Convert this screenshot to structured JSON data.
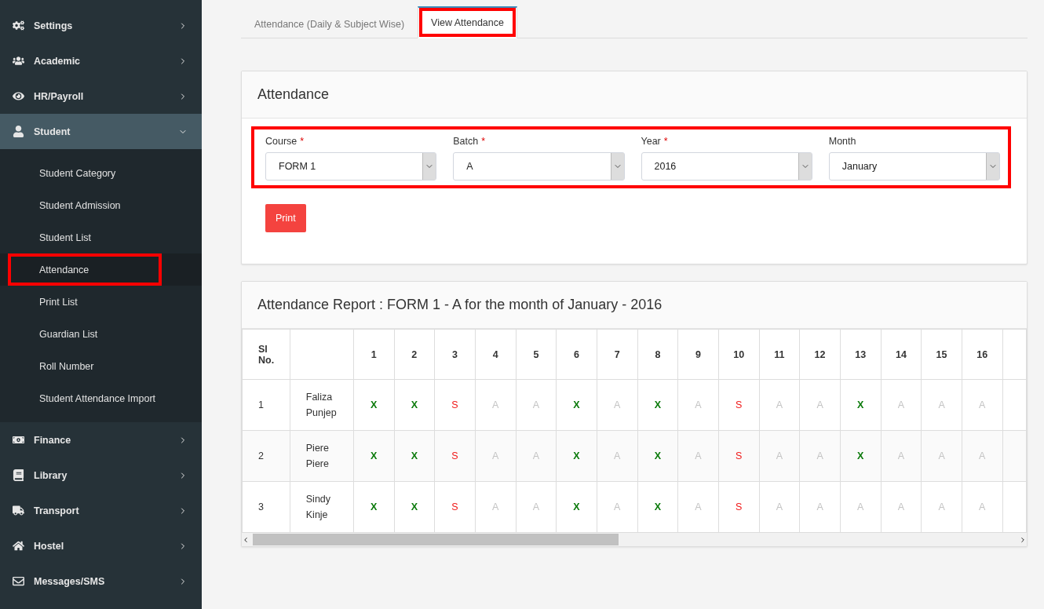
{
  "sidebar": {
    "items": [
      {
        "label": "Settings",
        "expanded": false,
        "selected": false
      },
      {
        "label": "Academic",
        "expanded": false,
        "selected": false
      },
      {
        "label": "HR/Payroll",
        "expanded": false,
        "selected": false
      },
      {
        "label": "Student",
        "expanded": true,
        "selected": true,
        "children": [
          {
            "label": "Student Category",
            "selected": false,
            "highlighted": false
          },
          {
            "label": "Student Admission",
            "selected": false,
            "highlighted": false
          },
          {
            "label": "Student List",
            "selected": false,
            "highlighted": false
          },
          {
            "label": "Attendance",
            "selected": true,
            "highlighted": true
          },
          {
            "label": "Print List",
            "selected": false,
            "highlighted": false
          },
          {
            "label": "Guardian List",
            "selected": false,
            "highlighted": false
          },
          {
            "label": "Roll Number",
            "selected": false,
            "highlighted": false
          },
          {
            "label": "Student Attendance Import",
            "selected": false,
            "highlighted": false
          }
        ]
      },
      {
        "label": "Finance",
        "expanded": false,
        "selected": false
      },
      {
        "label": "Library",
        "expanded": false,
        "selected": false
      },
      {
        "label": "Transport",
        "expanded": false,
        "selected": false
      },
      {
        "label": "Hostel",
        "expanded": false,
        "selected": false
      },
      {
        "label": "Messages/SMS",
        "expanded": false,
        "selected": false
      }
    ]
  },
  "tabs": [
    {
      "label": "Attendance (Daily & Subject Wise)",
      "selected": false,
      "highlighted": false
    },
    {
      "label": "View Attendance",
      "selected": true,
      "highlighted": true
    }
  ],
  "filter_panel": {
    "title": "Attendance",
    "highlighted": true,
    "fields": [
      {
        "label": "Course",
        "required": true,
        "value": "FORM 1"
      },
      {
        "label": "Batch",
        "required": true,
        "value": "A"
      },
      {
        "label": "Year",
        "required": true,
        "value": "2016"
      },
      {
        "label": "Month",
        "required": false,
        "value": "January"
      }
    ],
    "required_mark": "*",
    "print_button": "Print"
  },
  "report": {
    "title": "Attendance Report : FORM 1 - A for the month of January - 2016",
    "columns": [
      "Sl No.",
      "",
      "1",
      "2",
      "3",
      "4",
      "5",
      "6",
      "7",
      "8",
      "9",
      "10",
      "11",
      "12",
      "13",
      "14",
      "15",
      "16"
    ],
    "rows": [
      {
        "sl": "1",
        "name": "Faliza Punjep",
        "days": [
          {
            "text": "X",
            "kind": "present"
          },
          {
            "text": "X",
            "kind": "present"
          },
          {
            "text": "S",
            "kind": "special"
          },
          {
            "text": "A",
            "kind": "absent"
          },
          {
            "text": "A",
            "kind": "absent"
          },
          {
            "text": "X",
            "kind": "present"
          },
          {
            "text": "A",
            "kind": "absent"
          },
          {
            "text": "X",
            "kind": "present"
          },
          {
            "text": "A",
            "kind": "absent"
          },
          {
            "text": "S",
            "kind": "special"
          },
          {
            "text": "A",
            "kind": "absent"
          },
          {
            "text": "A",
            "kind": "absent"
          },
          {
            "text": "X",
            "kind": "present"
          },
          {
            "text": "A",
            "kind": "absent"
          },
          {
            "text": "A",
            "kind": "absent"
          },
          {
            "text": "A",
            "kind": "absent"
          }
        ]
      },
      {
        "sl": "2",
        "name": "Piere Piere",
        "days": [
          {
            "text": "X",
            "kind": "present"
          },
          {
            "text": "X",
            "kind": "present"
          },
          {
            "text": "S",
            "kind": "special"
          },
          {
            "text": "A",
            "kind": "absent"
          },
          {
            "text": "A",
            "kind": "absent"
          },
          {
            "text": "X",
            "kind": "present"
          },
          {
            "text": "A",
            "kind": "absent"
          },
          {
            "text": "X",
            "kind": "present"
          },
          {
            "text": "A",
            "kind": "absent"
          },
          {
            "text": "S",
            "kind": "special"
          },
          {
            "text": "A",
            "kind": "absent"
          },
          {
            "text": "A",
            "kind": "absent"
          },
          {
            "text": "X",
            "kind": "present"
          },
          {
            "text": "A",
            "kind": "absent"
          },
          {
            "text": "A",
            "kind": "absent"
          },
          {
            "text": "A",
            "kind": "absent"
          }
        ]
      },
      {
        "sl": "3",
        "name": "Sindy Kinje",
        "days": [
          {
            "text": "X",
            "kind": "present"
          },
          {
            "text": "X",
            "kind": "present"
          },
          {
            "text": "S",
            "kind": "special"
          },
          {
            "text": "A",
            "kind": "absent"
          },
          {
            "text": "A",
            "kind": "absent"
          },
          {
            "text": "X",
            "kind": "present"
          },
          {
            "text": "A",
            "kind": "absent"
          },
          {
            "text": "X",
            "kind": "present"
          },
          {
            "text": "A",
            "kind": "absent"
          },
          {
            "text": "S",
            "kind": "special"
          },
          {
            "text": "A",
            "kind": "absent"
          },
          {
            "text": "A",
            "kind": "absent"
          },
          {
            "text": "A",
            "kind": "absent"
          },
          {
            "text": "A",
            "kind": "absent"
          },
          {
            "text": "A",
            "kind": "absent"
          },
          {
            "text": "A",
            "kind": "absent"
          }
        ]
      }
    ]
  }
}
